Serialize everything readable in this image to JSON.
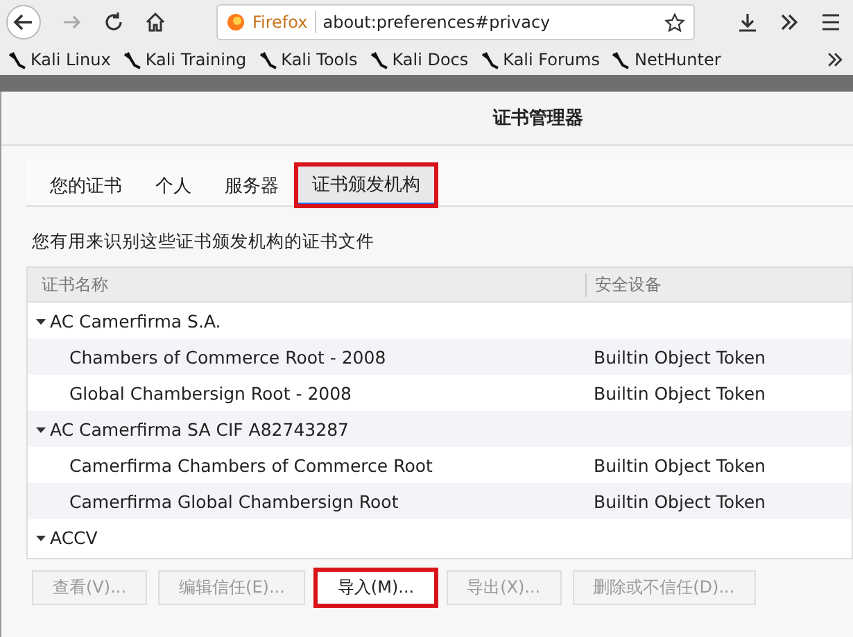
{
  "toolbar": {
    "identity": "Firefox",
    "url": "about:preferences#privacy"
  },
  "bookmarks": [
    "Kali Linux",
    "Kali Training",
    "Kali Tools",
    "Kali Docs",
    "Kali Forums",
    "NetHunter"
  ],
  "dialog": {
    "title": "证书管理器",
    "tabs": [
      {
        "label": "您的证书",
        "selected": false,
        "highlighted": false
      },
      {
        "label": "个人",
        "selected": false,
        "highlighted": false
      },
      {
        "label": "服务器",
        "selected": false,
        "highlighted": false
      },
      {
        "label": "证书颁发机构",
        "selected": true,
        "highlighted": true
      }
    ],
    "description": "您有用来识别这些证书颁发机构的证书文件",
    "table": {
      "columns": [
        "证书名称",
        "安全设备"
      ],
      "rows": [
        {
          "name": "AC Camerfirma S.A.",
          "expanded": true,
          "children": [
            {
              "name": "Chambers of Commerce Root - 2008",
              "device": "Builtin Object Token"
            },
            {
              "name": "Global Chambersign Root - 2008",
              "device": "Builtin Object Token"
            }
          ]
        },
        {
          "name": "AC Camerfirma SA CIF A82743287",
          "expanded": true,
          "children": [
            {
              "name": "Camerfirma Chambers of Commerce Root",
              "device": "Builtin Object Token"
            },
            {
              "name": "Camerfirma Global Chambersign Root",
              "device": "Builtin Object Token"
            }
          ]
        },
        {
          "name": "ACCV",
          "expanded": true,
          "children": []
        }
      ]
    },
    "buttons": [
      {
        "label": "查看(V)...",
        "disabled": true,
        "highlighted": false
      },
      {
        "label": "编辑信任(E)...",
        "disabled": true,
        "highlighted": false
      },
      {
        "label": "导入(M)...",
        "disabled": false,
        "highlighted": true
      },
      {
        "label": "导出(X)...",
        "disabled": true,
        "highlighted": false
      },
      {
        "label": "删除或不信任(D)...",
        "disabled": true,
        "highlighted": false
      }
    ]
  }
}
